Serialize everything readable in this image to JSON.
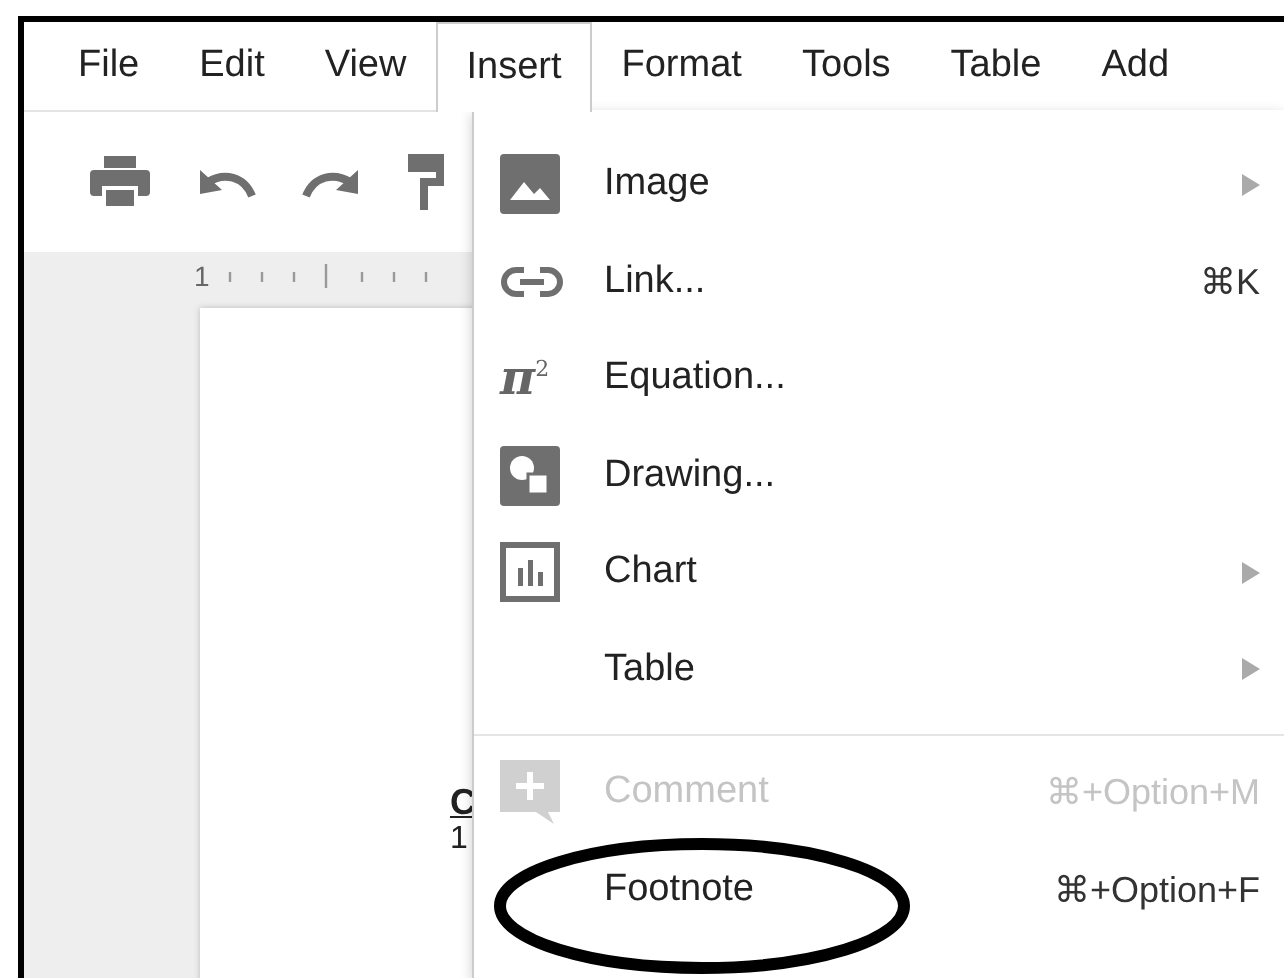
{
  "menu_bar": [
    {
      "label": "File",
      "selected": false
    },
    {
      "label": "Edit",
      "selected": false
    },
    {
      "label": "View",
      "selected": false
    },
    {
      "label": "Insert",
      "selected": true
    },
    {
      "label": "Format",
      "selected": false
    },
    {
      "label": "Tools",
      "selected": false
    },
    {
      "label": "Table",
      "selected": false
    },
    {
      "label": "Add",
      "selected": false
    }
  ],
  "ruler": {
    "label": "1"
  },
  "document": {
    "heading_fragment": "C",
    "text_fragment": "1"
  },
  "insert_menu": [
    {
      "kind": "image",
      "label": "Image",
      "submenu": true,
      "disabled": false
    },
    {
      "kind": "link",
      "label": "Link...",
      "shortcut": "⌘K",
      "disabled": false
    },
    {
      "kind": "equation",
      "symbol": "π$^{2}$",
      "label": "Equation...",
      "disabled": false
    },
    {
      "kind": "drawing",
      "label": "Drawing...",
      "disabled": false
    },
    {
      "kind": "chart",
      "label": "Chart",
      "submenu": true,
      "disabled": false
    },
    {
      "kind": "table",
      "label": "Table",
      "submenu": true,
      "disabled": false
    },
    {
      "kind": "comment",
      "label": "Comment",
      "shortcut": "⌘+Option+M",
      "separator_before": true,
      "disabled": true
    },
    {
      "kind": "footnote",
      "label": "Footnote",
      "shortcut": "⌘+Option+F",
      "disabled": false,
      "circled": true
    }
  ]
}
